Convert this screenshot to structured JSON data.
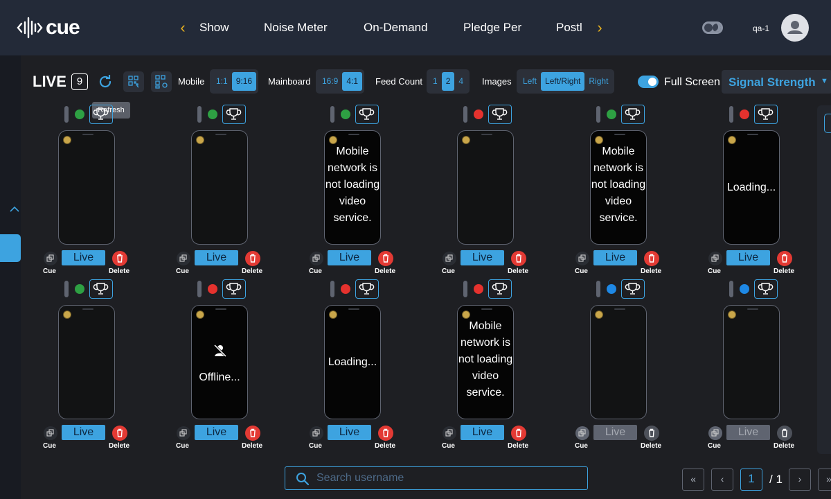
{
  "app": {
    "logo_text": "cue",
    "username": "qa-1"
  },
  "nav": {
    "tabs": [
      "Show",
      "Noise Meter",
      "On-Demand",
      "Pledge Per",
      "Postl"
    ]
  },
  "toolbar": {
    "title": "LIVE",
    "count": "9",
    "tooltip": "Refresh",
    "mobile_label": "Mobile",
    "mobile_options": [
      "1:1",
      "9:16"
    ],
    "mobile_selected": "9:16",
    "mainboard_label": "Mainboard",
    "mainboard_options": [
      "16:9",
      "4:1"
    ],
    "mainboard_selected": "4:1",
    "feed_label": "Feed Count",
    "feed_options": [
      "1",
      "2",
      "4"
    ],
    "feed_selected": "2",
    "images_label": "Images",
    "images_options": [
      "Left",
      "Left/Right",
      "Right"
    ],
    "images_selected": "Left/Right",
    "fullscreen_label": "Full Screen",
    "fullscreen_on": true,
    "signal_label": "Signal Strength"
  },
  "colors": {
    "accent": "#3da3e0",
    "green": "#2ea043",
    "red": "#e5322e",
    "blue": "#1e88e5",
    "delete": "#e33a34",
    "disabled": "#5f6470"
  },
  "tile_labels": {
    "live": "Live",
    "cue": "Cue",
    "delete": "Delete"
  },
  "tiles": [
    {
      "status": "green",
      "message": "",
      "state": "active"
    },
    {
      "status": "green",
      "message": "",
      "state": "active"
    },
    {
      "status": "green",
      "message": "Mobile network is not loading video service.",
      "state": "active"
    },
    {
      "status": "red",
      "message": "",
      "state": "active"
    },
    {
      "status": "green",
      "message": "Mobile network is not loading video service.",
      "state": "active"
    },
    {
      "status": "red",
      "message": "Loading...",
      "state": "active"
    },
    {
      "status": "green",
      "message": "",
      "state": "active"
    },
    {
      "status": "red",
      "message": "Offline...",
      "offline_icon": "user-off-icon",
      "state": "active"
    },
    {
      "status": "red",
      "message": "Loading...",
      "state": "active"
    },
    {
      "status": "red",
      "message": "Mobile network is not loading video service.",
      "state": "active"
    },
    {
      "status": "blue",
      "message": "",
      "state": "disabled"
    },
    {
      "status": "blue",
      "message": "",
      "state": "disabled"
    }
  ],
  "search": {
    "placeholder": "Search username",
    "value": ""
  },
  "pagination": {
    "current": "1",
    "total": "/ 1"
  }
}
